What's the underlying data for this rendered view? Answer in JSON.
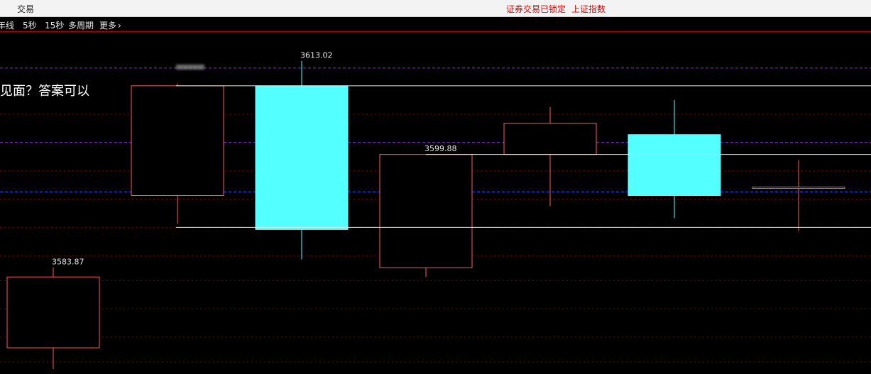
{
  "titlebar": {
    "title": "交易",
    "lock_status": "证券交易已锁定",
    "index_name": "上证指数"
  },
  "toolbar": {
    "items": [
      "年线",
      "5秒",
      "15秒",
      "多周期",
      "更多"
    ]
  },
  "overlay_text": "见面？答案可以",
  "colors": {
    "up": "#ff5a5a",
    "down": "#54ffff",
    "grid": "#7a0000",
    "purple": "#8a2be2",
    "blue": "#3050ff",
    "hline": "#e8e8e8"
  },
  "chart_data": {
    "type": "candlestick",
    "ylim": [
      3570,
      3616
    ],
    "grid_levels": [
      3612,
      3605.5,
      3601.5,
      3597.5,
      3593.5,
      3589.5,
      3585.5,
      3582,
      3578,
      3574,
      3570.5
    ],
    "purple_lines": [
      3612,
      3601.5
    ],
    "blue_dashed": 3594.5,
    "horizontal_lines": [
      3609.5,
      3599.8,
      3589.5
    ],
    "candles": [
      {
        "open": 3572.5,
        "close": 3582.5,
        "high": 3583.87,
        "low": 3569.5,
        "dir": "up",
        "high_label": "3583.87"
      },
      {
        "open": 3594.0,
        "close": 3609.5,
        "high": 3609.8,
        "low": 3590.0,
        "dir": "up",
        "high_label": ""
      },
      {
        "open": 3609.5,
        "close": 3589.2,
        "high": 3613.02,
        "low": 3585.0,
        "dir": "down",
        "high_label": "3613.02"
      },
      {
        "open": 3583.8,
        "close": 3599.8,
        "high": 3599.88,
        "low": 3582.5,
        "dir": "up",
        "high_label": "3599.88"
      },
      {
        "open": 3599.8,
        "close": 3604.2,
        "high": 3606.5,
        "low": 3592.5,
        "dir": "up",
        "high_label": ""
      },
      {
        "open": 3602.6,
        "close": 3594.0,
        "high": 3607.5,
        "low": 3590.8,
        "dir": "down",
        "high_label": ""
      },
      {
        "open": 3595.0,
        "close": 3595.2,
        "high": 3599.0,
        "low": 3589.0,
        "dir": "up",
        "high_label": ""
      }
    ]
  }
}
